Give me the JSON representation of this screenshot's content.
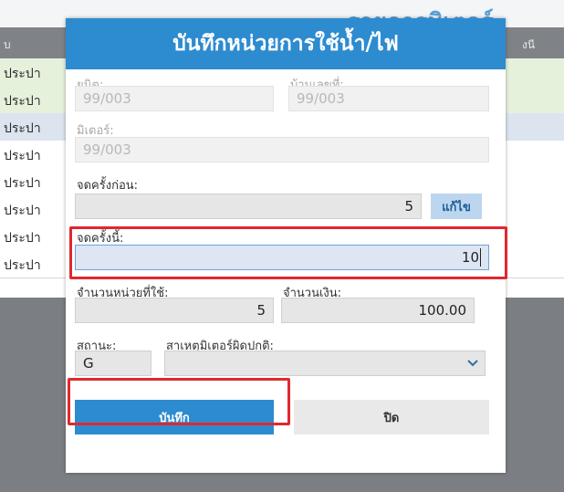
{
  "background": {
    "title": "รายการมิเตอร์",
    "column_left": "บ",
    "column_right": "งนี",
    "row_text": "ประปา",
    "row_count": 8
  },
  "modal": {
    "title": "บันทึกหน่วยการใช้น้ำ/ไฟ",
    "unit": {
      "label": "ยูนิต:",
      "value": "99/003"
    },
    "house_no": {
      "label": "บ้านเลขที่:",
      "value": "99/003"
    },
    "meter": {
      "label": "มิเตอร์:",
      "value": "99/003"
    },
    "prev_reading": {
      "label": "จดครั้งก่อน:",
      "value": "5"
    },
    "edit_button": "แก้ไข",
    "current_reading": {
      "label": "จดครั้งนี้:",
      "value": "10"
    },
    "units_used": {
      "label": "จำนวนหน่วยที่ใช้:",
      "value": "5"
    },
    "amount": {
      "label": "จำนวนเงิน:",
      "value": "100.00"
    },
    "status": {
      "label": "สถานะ:",
      "value": "G"
    },
    "abnormal_reason": {
      "label": "สาเหตุมิเตอร์ผิดปกติ:",
      "value": ""
    },
    "save_button": "บันทึก",
    "close_button": "ปิด"
  },
  "colors": {
    "header_blue": "#2d8bd0",
    "highlight_red": "#e0282e",
    "edit_button_bg": "#bcd6ef"
  }
}
